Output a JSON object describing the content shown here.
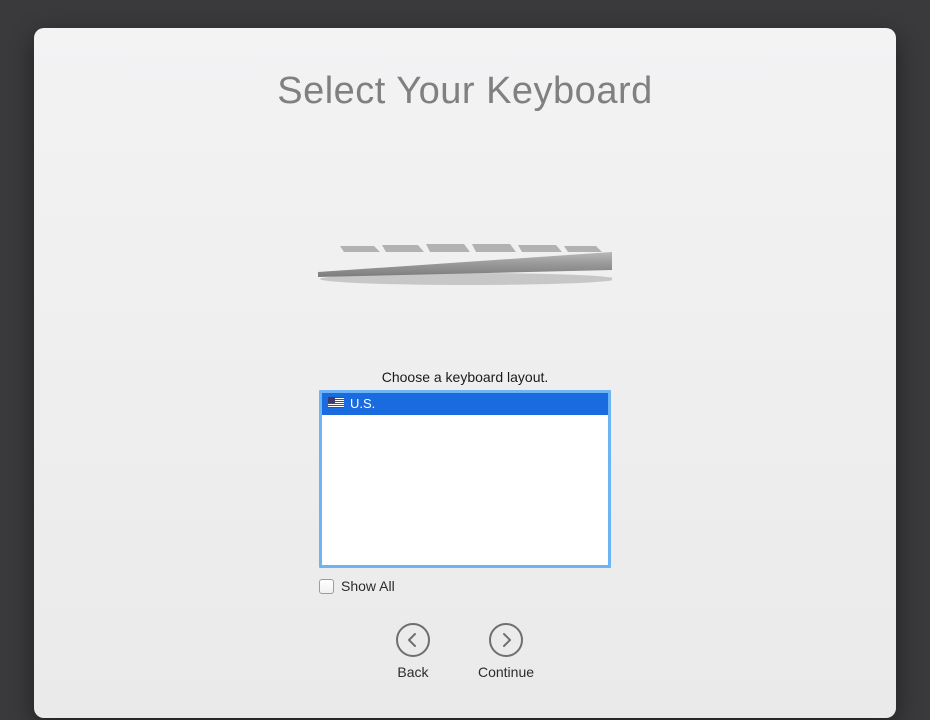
{
  "title": "Select Your Keyboard",
  "prompt": "Choose a keyboard layout.",
  "layouts": [
    {
      "flag": "us",
      "label": "U.S.",
      "selected": true
    }
  ],
  "show_all": {
    "label": "Show All",
    "checked": false
  },
  "nav": {
    "back_label": "Back",
    "continue_label": "Continue"
  },
  "colors": {
    "selection": "#1a6be0",
    "focus_ring": "#6cb4f5"
  }
}
